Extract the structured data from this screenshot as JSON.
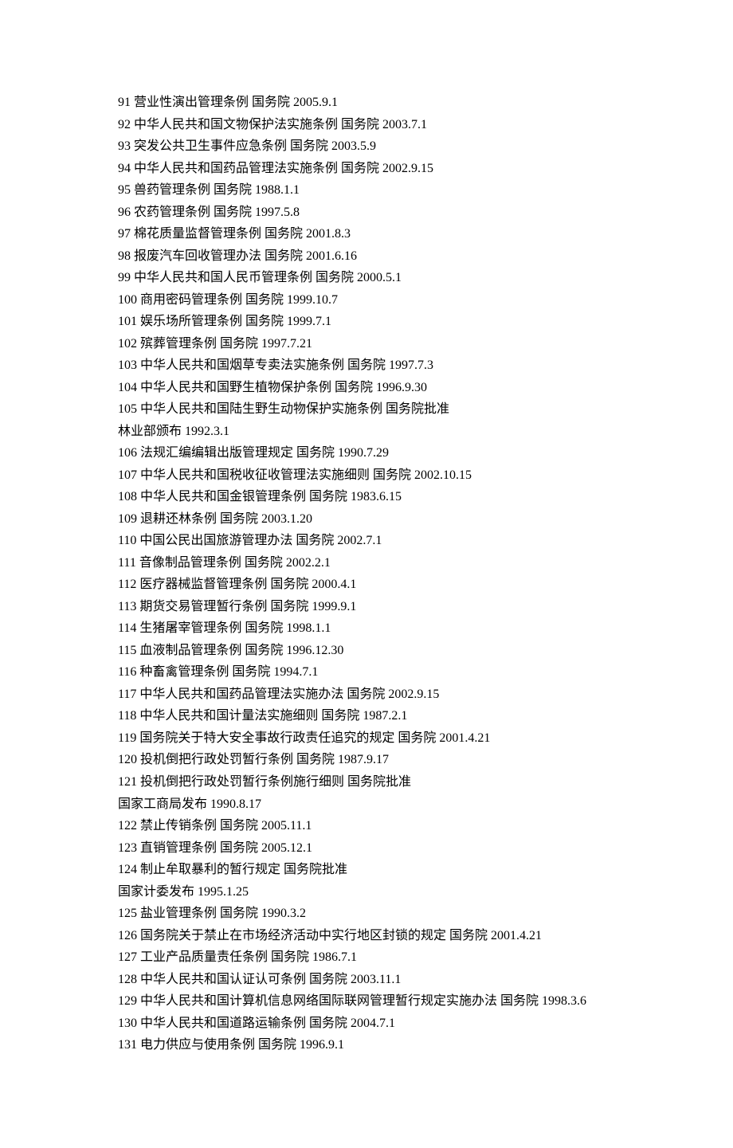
{
  "lines": [
    "91 营业性演出管理条例 国务院 2005.9.1",
    "92 中华人民共和国文物保护法实施条例 国务院 2003.7.1",
    "93 突发公共卫生事件应急条例 国务院 2003.5.9",
    "94 中华人民共和国药品管理法实施条例 国务院 2002.9.15",
    "95 兽药管理条例 国务院 1988.1.1",
    "96 农药管理条例 国务院 1997.5.8",
    "97 棉花质量监督管理条例 国务院 2001.8.3",
    "98 报废汽车回收管理办法 国务院 2001.6.16",
    "99 中华人民共和国人民币管理条例 国务院 2000.5.1",
    "100 商用密码管理条例 国务院 1999.10.7",
    "101 娱乐场所管理条例 国务院 1999.7.1",
    "102 殡葬管理条例 国务院 1997.7.21",
    "103 中华人民共和国烟草专卖法实施条例 国务院 1997.7.3",
    "104 中华人民共和国野生植物保护条例 国务院 1996.9.30",
    "105 中华人民共和国陆生野生动物保护实施条例 国务院批准",
    "林业部颁布 1992.3.1",
    "106 法规汇编编辑出版管理规定 国务院 1990.7.29",
    "107 中华人民共和国税收征收管理法实施细则 国务院 2002.10.15",
    "108 中华人民共和国金银管理条例 国务院 1983.6.15",
    "109 退耕还林条例 国务院 2003.1.20",
    "110 中国公民出国旅游管理办法 国务院 2002.7.1",
    "111 音像制品管理条例 国务院 2002.2.1",
    "112 医疗器械监督管理条例 国务院 2000.4.1",
    "113 期货交易管理暂行条例 国务院 1999.9.1",
    "114 生猪屠宰管理条例 国务院 1998.1.1",
    "115 血液制品管理条例 国务院 1996.12.30",
    "116 种畜禽管理条例 国务院 1994.7.1",
    "117 中华人民共和国药品管理法实施办法 国务院 2002.9.15",
    "118 中华人民共和国计量法实施细则 国务院 1987.2.1",
    "119 国务院关于特大安全事故行政责任追究的规定 国务院 2001.4.21",
    "120 投机倒把行政处罚暂行条例 国务院 1987.9.17",
    "121 投机倒把行政处罚暂行条例施行细则 国务院批准",
    "国家工商局发布 1990.8.17",
    "122 禁止传销条例 国务院 2005.11.1",
    "123 直销管理条例 国务院 2005.12.1",
    "124 制止牟取暴利的暂行规定 国务院批准",
    "国家计委发布 1995.1.25",
    "125 盐业管理条例 国务院 1990.3.2",
    "126 国务院关于禁止在市场经济活动中实行地区封锁的规定 国务院 2001.4.21",
    "127 工业产品质量责任条例 国务院 1986.7.1",
    "128 中华人民共和国认证认可条例 国务院 2003.11.1",
    "129 中华人民共和国计算机信息网络国际联网管理暂行规定实施办法 国务院 1998.3.6",
    "130 中华人民共和国道路运输条例 国务院 2004.7.1",
    "131 电力供应与使用条例 国务院 1996.9.1"
  ]
}
